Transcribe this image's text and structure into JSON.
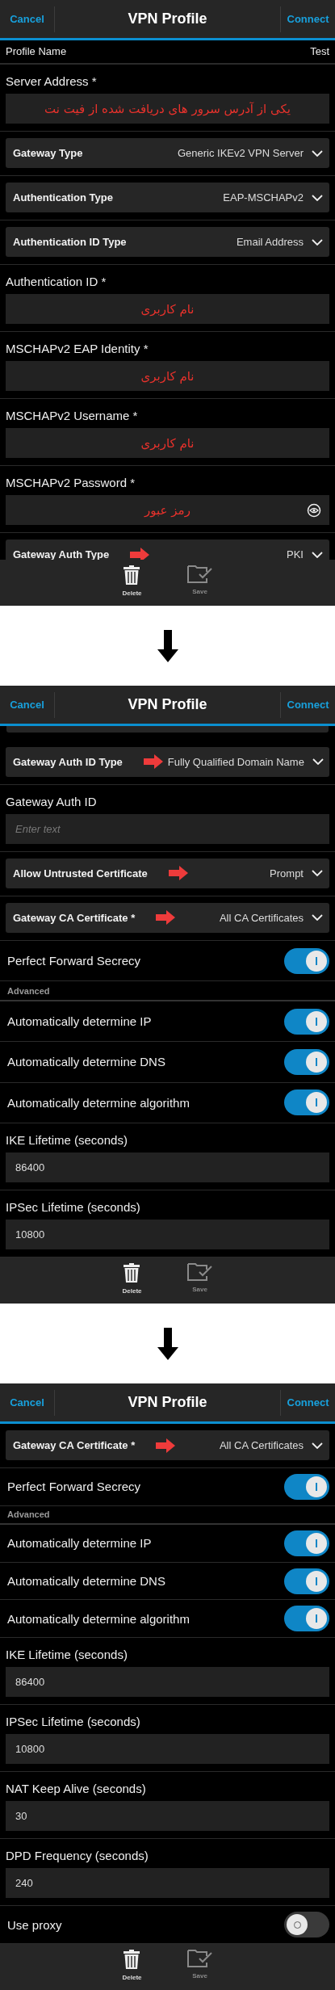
{
  "screens": [
    {
      "header": {
        "cancel": "Cancel",
        "title": "VPN Profile",
        "connect": "Connect"
      },
      "items": [
        {
          "kind": "profile",
          "label": "Profile Name",
          "value": "Test"
        },
        {
          "kind": "input",
          "label": "Server Address *",
          "value": "یکی از آدرس سرور های دریافت شده از فیت نت",
          "annotated": true
        },
        {
          "kind": "dropdown",
          "label": "Gateway Type",
          "value": "Generic IKEv2 VPN Server",
          "marked": false
        },
        {
          "kind": "dropdown",
          "label": "Authentication Type",
          "value": "EAP-MSCHAPv2",
          "marked": false
        },
        {
          "kind": "dropdown",
          "label": "Authentication ID Type",
          "value": "Email Address",
          "marked": false
        },
        {
          "kind": "input",
          "label": "Authentication ID *",
          "value": "نام کاربری",
          "annotated": true
        },
        {
          "kind": "input",
          "label": "MSCHAPv2 EAP Identity *",
          "value": "نام کاربری",
          "annotated": true
        },
        {
          "kind": "input",
          "label": "MSCHAPv2 Username *",
          "value": "نام کاربری",
          "annotated": true
        },
        {
          "kind": "password",
          "label": "MSCHAPv2 Password *",
          "value": "رمز عبور",
          "annotated": true
        },
        {
          "kind": "dropdown",
          "label": "Gateway Auth Type",
          "value": "PKI",
          "marked": true
        }
      ],
      "toolbar": [
        {
          "label": "Delete",
          "disabled": false
        },
        {
          "label": "Save",
          "disabled": true
        }
      ]
    },
    {
      "header": {
        "cancel": "Cancel",
        "title": "VPN Profile",
        "connect": "Connect"
      },
      "items": [
        {
          "kind": "sliver"
        },
        {
          "kind": "dropdown",
          "label": "Gateway Auth ID Type",
          "value": "Fully Qualified Domain Name",
          "marked": true
        },
        {
          "kind": "input",
          "label": "Gateway Auth ID",
          "placeholder": "Enter text"
        },
        {
          "kind": "dropdown",
          "label": "Allow Untrusted Certificate",
          "value": "Prompt",
          "marked": true
        },
        {
          "kind": "dropdown",
          "label": "Gateway CA Certificate *",
          "value": "All CA Certificates",
          "marked": true
        },
        {
          "kind": "toggle",
          "label": "Perfect Forward Secrecy",
          "on": true
        },
        {
          "kind": "section",
          "label": "Advanced"
        },
        {
          "kind": "toggle",
          "label": "Automatically determine IP",
          "on": true
        },
        {
          "kind": "toggle",
          "label": "Automatically determine DNS",
          "on": true
        },
        {
          "kind": "toggle",
          "label": "Automatically determine algorithm",
          "on": true
        },
        {
          "kind": "input",
          "label": "IKE Lifetime (seconds)",
          "value": "86400",
          "annotated": false
        },
        {
          "kind": "input",
          "label": "IPSec Lifetime (seconds)",
          "value": "10800",
          "annotated": false
        }
      ],
      "toolbar": [
        {
          "label": "Delete",
          "disabled": false
        },
        {
          "label": "Save",
          "disabled": true
        }
      ]
    },
    {
      "header": {
        "cancel": "Cancel",
        "title": "VPN Profile",
        "connect": "Connect"
      },
      "items": [
        {
          "kind": "dropdown",
          "label": "Gateway CA Certificate *",
          "value": "All CA Certificates",
          "marked": true
        },
        {
          "kind": "toggle",
          "label": "Perfect Forward Secrecy",
          "on": true
        },
        {
          "kind": "section",
          "label": "Advanced"
        },
        {
          "kind": "toggle",
          "label": "Automatically determine IP",
          "on": true
        },
        {
          "kind": "toggle",
          "label": "Automatically determine DNS",
          "on": true
        },
        {
          "kind": "toggle",
          "label": "Automatically determine algorithm",
          "on": true
        },
        {
          "kind": "input",
          "label": "IKE Lifetime (seconds)",
          "value": "86400",
          "annotated": false
        },
        {
          "kind": "input",
          "label": "IPSec Lifetime (seconds)",
          "value": "10800",
          "annotated": false
        },
        {
          "kind": "input",
          "label": "NAT Keep Alive (seconds)",
          "value": "30",
          "annotated": false
        },
        {
          "kind": "input",
          "label": "DPD Frequency (seconds)",
          "value": "240",
          "annotated": false
        },
        {
          "kind": "toggle",
          "label": "Use proxy",
          "on": false
        }
      ],
      "toolbar": [
        {
          "label": "Delete",
          "disabled": false
        },
        {
          "label": "Save",
          "disabled": true
        }
      ]
    }
  ]
}
